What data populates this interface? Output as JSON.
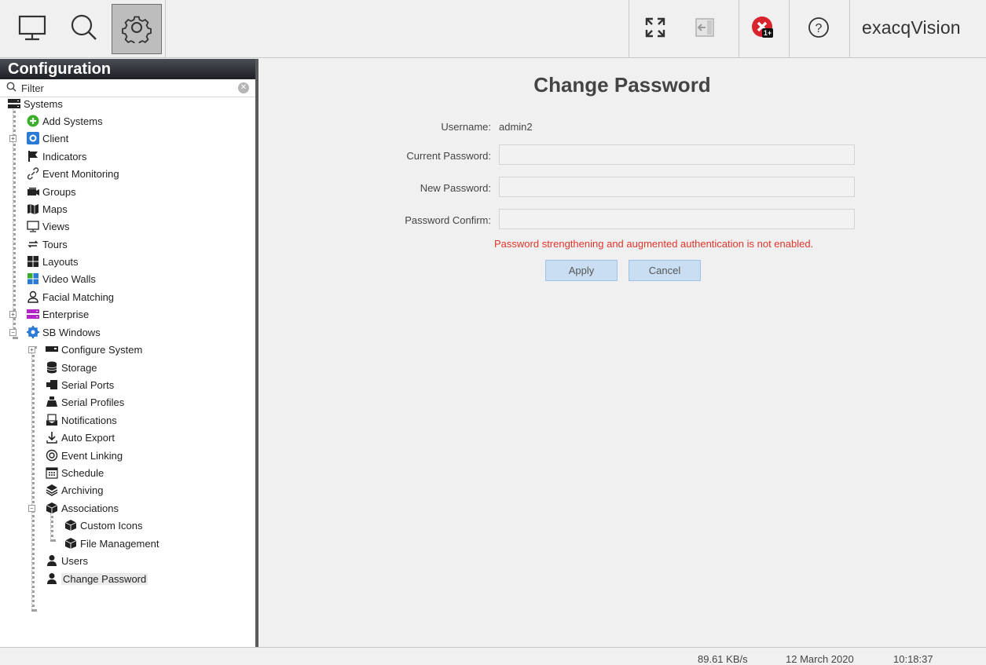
{
  "toolbar": {
    "brand": "exacqVision",
    "alert_badge": "1+"
  },
  "sidebar": {
    "header": "Configuration",
    "filter_placeholder": "Filter",
    "tree": [
      {
        "label": "Systems",
        "icon": "server-icon"
      },
      {
        "label": "Add Systems",
        "icon": "add-icon"
      },
      {
        "label": "Client",
        "icon": "client-gear-icon"
      },
      {
        "label": "Indicators",
        "icon": "flag-icon"
      },
      {
        "label": "Event Monitoring",
        "icon": "link-icon"
      },
      {
        "label": "Groups",
        "icon": "camera-group-icon"
      },
      {
        "label": "Maps",
        "icon": "map-icon"
      },
      {
        "label": "Views",
        "icon": "monitor-icon"
      },
      {
        "label": "Tours",
        "icon": "cycle-icon"
      },
      {
        "label": "Layouts",
        "icon": "layout-icon"
      },
      {
        "label": "Video Walls",
        "icon": "video-wall-icon"
      },
      {
        "label": "Facial Matching",
        "icon": "face-icon"
      },
      {
        "label": "Enterprise",
        "icon": "enterprise-icon"
      },
      {
        "label": "SB Windows",
        "icon": "system-gear-icon"
      },
      {
        "label": "Configure System",
        "icon": "device-icon"
      },
      {
        "label": "Storage",
        "icon": "database-icon"
      },
      {
        "label": "Serial Ports",
        "icon": "serial-port-icon"
      },
      {
        "label": "Serial Profiles",
        "icon": "register-icon"
      },
      {
        "label": "Notifications",
        "icon": "mail-icon"
      },
      {
        "label": "Auto Export",
        "icon": "download-icon"
      },
      {
        "label": "Event Linking",
        "icon": "event-link-icon"
      },
      {
        "label": "Schedule",
        "icon": "calendar-icon"
      },
      {
        "label": "Archiving",
        "icon": "layers-icon"
      },
      {
        "label": "Associations",
        "icon": "cube-icon"
      },
      {
        "label": "Custom Icons",
        "icon": "cube-icon"
      },
      {
        "label": "File Management",
        "icon": "cube-icon"
      },
      {
        "label": "Users",
        "icon": "user-icon"
      },
      {
        "label": "Change Password",
        "icon": "user-icon"
      }
    ]
  },
  "main": {
    "title": "Change Password",
    "username_label": "Username:",
    "username_value": "admin2",
    "current_password_label": "Current Password:",
    "new_password_label": "New Password:",
    "confirm_password_label": "Password Confirm:",
    "current_password_value": "",
    "new_password_value": "",
    "confirm_password_value": "",
    "warning": "Password strengthening and augmented authentication is not enabled.",
    "apply_label": "Apply",
    "cancel_label": "Cancel"
  },
  "status": {
    "throughput": "89.61 KB/s",
    "date": "12 March 2020",
    "time": "10:18:37"
  },
  "colors": {
    "accent_blue": "#c9def3",
    "warning_red": "#e0352b",
    "header_dark": "#1e1f24"
  }
}
